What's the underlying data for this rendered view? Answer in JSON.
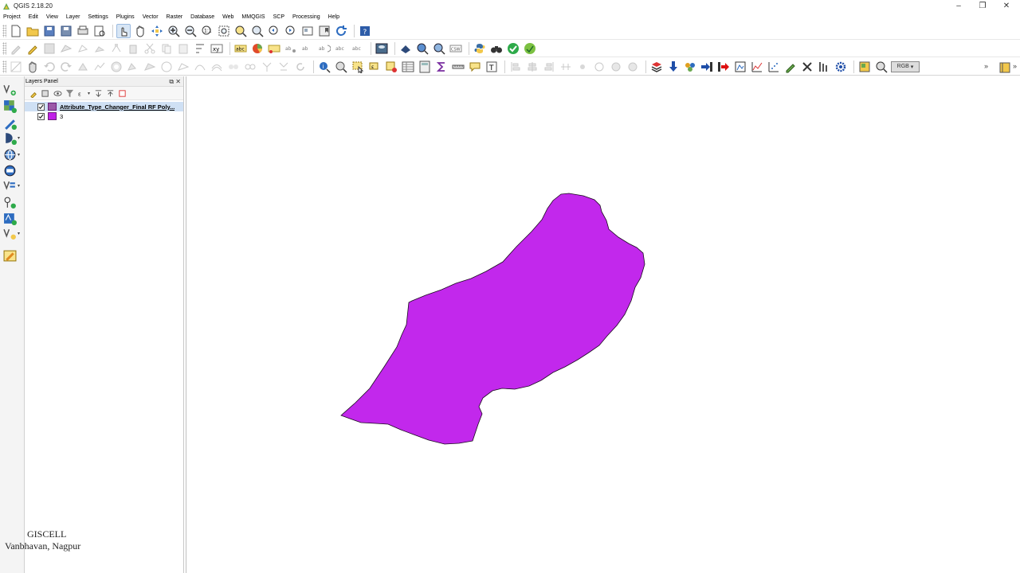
{
  "window": {
    "title": "QGIS 2.18.20",
    "minimize": "–",
    "restore": "❐",
    "close": "✕"
  },
  "menu": [
    "Project",
    "Edit",
    "View",
    "Layer",
    "Settings",
    "Plugins",
    "Vector",
    "Raster",
    "Database",
    "Web",
    "MMQGIS",
    "SCP",
    "Processing",
    "Help"
  ],
  "toolbar": {
    "rgb_label": "RGB",
    "overflow": "»"
  },
  "layers_panel": {
    "title": "Layers Panel",
    "float_btn": "⧉",
    "close_btn": "✕",
    "layers": [
      {
        "name": "Attribute_Type_Changer_Final RF Poly...",
        "checked": true,
        "swatch_color": "#9b59a8",
        "selected": true
      },
      {
        "name": "3",
        "checked": true,
        "swatch_color": "#c020e8",
        "selected": false
      }
    ]
  },
  "map": {
    "fill_color": "#c228ec",
    "stroke_color": "#1a0a1e"
  },
  "watermark": {
    "line1": "GISCELL",
    "line2": "Vanbhavan, Nagpur"
  }
}
